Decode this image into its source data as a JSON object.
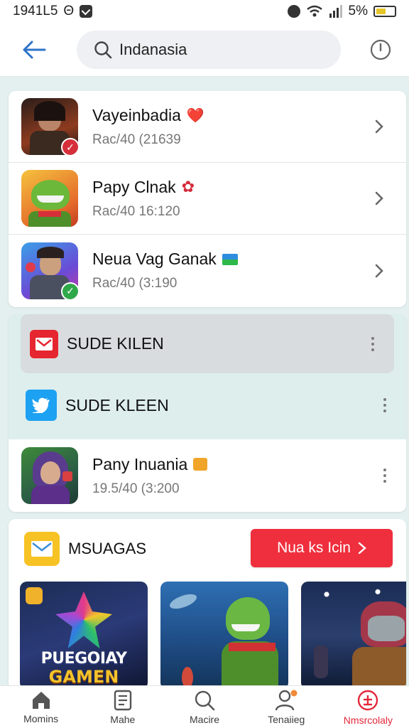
{
  "status_bar": {
    "time": "1941L5",
    "battery_text": "5%",
    "battery_level": 0.55
  },
  "header": {
    "search_value": "Indanasia"
  },
  "games": [
    {
      "title": "Vayeinbadia",
      "subtitle": "Rac/40 (21639",
      "emoji": "❤️"
    },
    {
      "title": "Papy Clnak",
      "subtitle": "Rac/40 16:120",
      "emoji": "✿"
    },
    {
      "title": "Neua Vag Ganak",
      "subtitle": "Rac/40 (3:190",
      "emoji": "▬"
    }
  ],
  "apps": [
    {
      "label": "SUDE KILEN",
      "icon": "mail-app-icon"
    },
    {
      "label": "SUDE KLEEN",
      "icon": "twitter-bird-icon"
    }
  ],
  "pany": {
    "title": "Pany Inuania",
    "subtitle": "19.5/40 (3:200"
  },
  "messages": {
    "title": "MSUAGAS",
    "cta_label": "Nua ks Icin",
    "promo_text_1": "PUEGOIAY",
    "promo_text_2": "GAMEN"
  },
  "tabs": [
    {
      "label": "Momins",
      "icon": "home-icon"
    },
    {
      "label": "Mahe",
      "icon": "document-icon"
    },
    {
      "label": "Macire",
      "icon": "search-icon"
    },
    {
      "label": "Tenaiieg",
      "icon": "profile-icon"
    },
    {
      "label": "Nmsrcolaly",
      "icon": "plus-circle-icon",
      "active": true
    }
  ],
  "colors": {
    "accent_red": "#ef2f3d",
    "accent_blue": "#2e73c9",
    "background": "#e3f0ef"
  }
}
